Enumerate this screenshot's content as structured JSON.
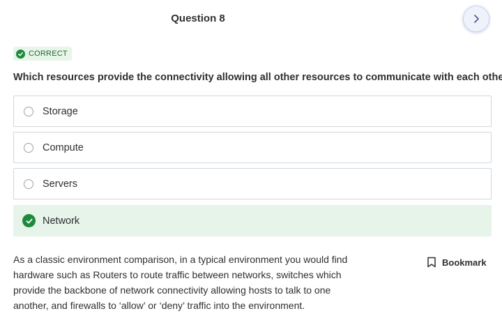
{
  "header": {
    "title": "Question 8",
    "next_icon": "chevron-right-icon"
  },
  "result_badge": {
    "label": "CORRECT",
    "icon": "check-circle-icon",
    "color": "#1e8a3b"
  },
  "question": {
    "text": "Which resources provide the connectivity allowing all other resources to communicate with each other?"
  },
  "options": [
    {
      "label": "Storage",
      "state": "unselected"
    },
    {
      "label": "Compute",
      "state": "unselected"
    },
    {
      "label": "Servers",
      "state": "unselected"
    },
    {
      "label": "Network",
      "state": "correct"
    }
  ],
  "explanation": {
    "text": "As a classic environment comparison, in a typical environment you would find hardware such as Routers to route traffic between networks, switches which provide the backbone of network connectivity allowing hosts to talk to one another, and firewalls to ‘allow’ or ‘deny’ traffic into the environment."
  },
  "bookmark": {
    "label": "Bookmark",
    "icon": "bookmark-icon"
  },
  "colors": {
    "correct_bg": "#e6f4ea",
    "correct_accent": "#1e8a3b",
    "border": "#d1d7dc"
  }
}
